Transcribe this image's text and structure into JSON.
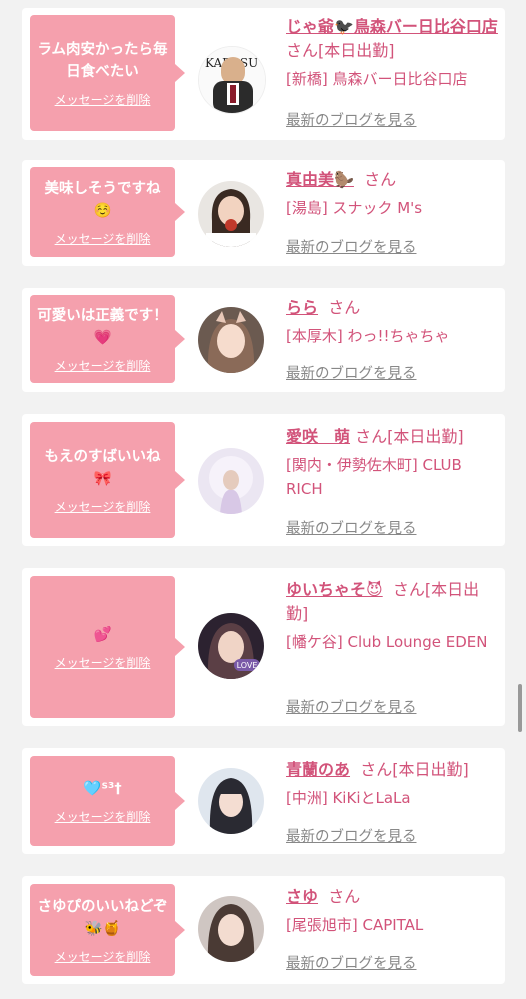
{
  "cards": [
    {
      "message": "ラム肉安かったら毎日食べたい",
      "delete_label": "メッセージを削除",
      "name": "じゃ爺🐦‍⬛鳥森バー日比谷口店",
      "san": "さん",
      "status": "[本日出勤]",
      "shop": "[新橋] 鳥森バー日比谷口店",
      "blog_label": "最新のブログを見る",
      "avatar_text": "KARASU MORI BAR"
    },
    {
      "message": "美味しそうですね☺️",
      "delete_label": "メッセージを削除",
      "name": "真由美🦫",
      "san": "さん",
      "status": "",
      "shop": "[湯島] スナック M's",
      "blog_label": "最新のブログを見る"
    },
    {
      "message": "可愛いは正義です！💗",
      "delete_label": "メッセージを削除",
      "name": "らら",
      "san": "さん",
      "status": "",
      "shop": "[本厚木] わっ!!ちゃちゃ",
      "blog_label": "最新のブログを見る"
    },
    {
      "message": "もえのすばいいね🎀",
      "delete_label": "メッセージを削除",
      "name": "愛咲　萌",
      "san": "さん",
      "status": "[本日出勤]",
      "shop": "[関内・伊勢佐木町] CLUB RICH",
      "blog_label": "最新のブログを見る"
    },
    {
      "message": "💕",
      "delete_label": "メッセージを削除",
      "name": "ゆいちゃそ😈",
      "san": "さん",
      "status": "[本日出勤]",
      "shop": "[幡ケ谷] Club Lounge EDEN",
      "blog_label": "最新のブログを見る",
      "avatar_text": "LOVE"
    },
    {
      "message": "🩵ᔆ³†",
      "delete_label": "メッセージを削除",
      "name": "青蘭のあ",
      "san": "さん",
      "status": "[本日出勤]",
      "shop": "[中洲] KiKiとLaLa",
      "blog_label": "最新のブログを見る"
    },
    {
      "message": "さゆぴのいいねどぞ🐝🍯",
      "delete_label": "メッセージを削除",
      "name": "さゆ",
      "san": "さん",
      "status": "",
      "shop": "[尾張旭市] CAPITAL",
      "blog_label": "最新のブログを見る"
    }
  ],
  "colors": {
    "pink_bubble": "#f5a0ad",
    "name_pink": "#d2537a",
    "link_gray": "#888888",
    "background": "#f2f2f2"
  }
}
